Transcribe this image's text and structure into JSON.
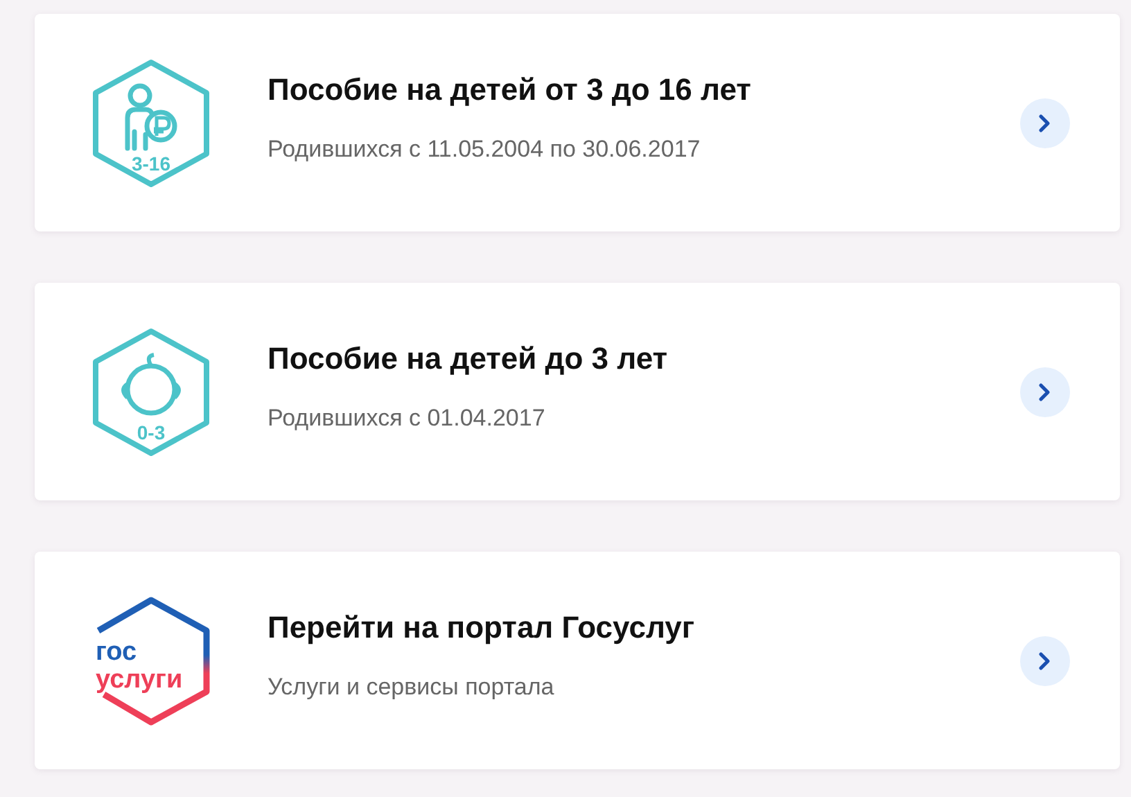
{
  "cards": [
    {
      "kind": "child",
      "icon_label": "3-16",
      "title": "Пособие на детей от 3 до 16 лет",
      "subtitle": "Родившихся с 11.05.2004 по 30.06.2017"
    },
    {
      "kind": "baby",
      "icon_label": "0-3",
      "title": "Пособие на детей до 3 лет",
      "subtitle": "Родившихся с 01.04.2017"
    },
    {
      "kind": "logo",
      "logo_lines": [
        "гос",
        "услуги"
      ],
      "title": "Перейти на портал Госуслуг",
      "subtitle": "Услуги и сервисы портала"
    }
  ]
}
